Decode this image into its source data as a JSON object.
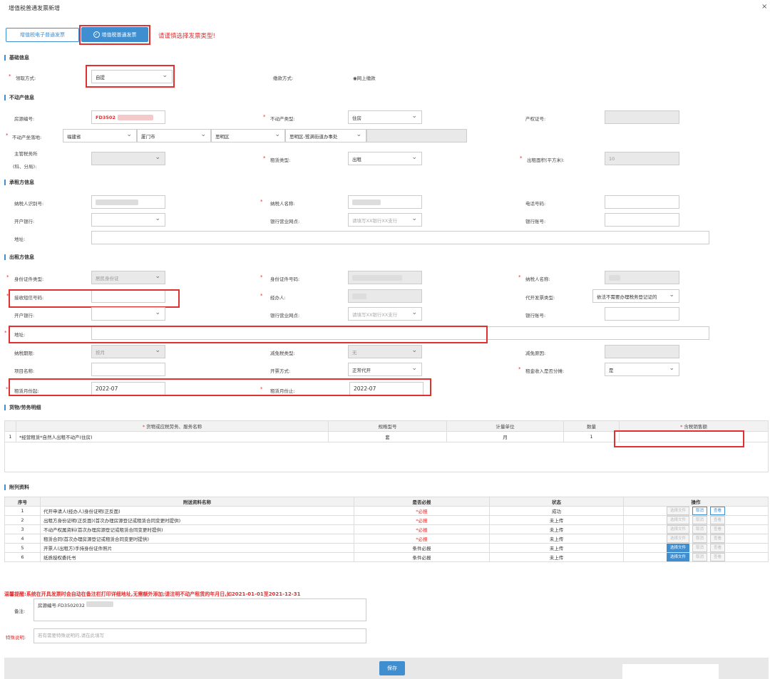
{
  "window": {
    "title": "增值税普通发票新增",
    "close": "×"
  },
  "tabs": [
    {
      "label": "增值税电子普通发票"
    },
    {
      "label": "增值税普通发票"
    }
  ],
  "warning": "请谨慎选择发票类型!",
  "sections": {
    "basic": "基础信息",
    "property": "不动产信息",
    "lessee": "承租方信息",
    "lessor": "出租方信息",
    "goods": "货物/劳务明细",
    "attachments": "附列资料"
  },
  "basic": {
    "pickup_label": "领取方式:",
    "pickup_value": "自提",
    "pay_label": "缴款方式:",
    "pay_value": "网上缴款"
  },
  "property": {
    "source_no_label": "房源编号:",
    "source_no_value": "FD3502",
    "type_label": "不动产类型:",
    "type_value": "住房",
    "cert_label": "产权证号:",
    "location_label": "不动产坐落地:",
    "province": "福建省",
    "city": "厦门市",
    "district": "思明区",
    "street": "思明区-鹭满街道办事处",
    "tax_office_label": "主管税务所",
    "tax_office_label2": "(科、分局):",
    "lease_type_label": "租赁类型:",
    "lease_type_value": "出租",
    "area_label": "出租面积(平方米):",
    "area_value": "10"
  },
  "lessee": {
    "taxid_label": "纳税人识别号:",
    "name_label": "纳税人名称:",
    "phone_label": "电话号码:",
    "bank_label": "开户银行:",
    "branch_label": "银行营业网点:",
    "branch_placeholder": "请填写XX银行XX支行",
    "account_label": "银行账号:",
    "address_label": "地址:"
  },
  "lessor": {
    "id_type_label": "身份证件类型:",
    "id_type_value": "居民身份证",
    "id_no_label": "身份证件号码:",
    "name_label": "纳税人名称:",
    "sms_label": "接收短信号码:",
    "agent_label": "经办人:",
    "invoice_type_label": "代开发票类型:",
    "invoice_type_value": "依法不需要办理税务登记证的",
    "bank_label": "开户银行:",
    "branch_label": "银行营业网点:",
    "branch_placeholder": "请填写XX银行XX支行",
    "account_label": "银行账号:",
    "address_label": "地址:",
    "period_label": "纳税期限:",
    "period_value": "按月",
    "reduce_type_label": "减免税类型:",
    "reduce_type_value": "无",
    "reduce_reason_label": "减免原因:",
    "project_label": "项目名称:",
    "issue_label": "开票方式:",
    "issue_value": "正常代开",
    "split_label": "租金收入是否分摊:",
    "split_value": "是",
    "start_label": "租赁月份起:",
    "start_value": "2022-07",
    "end_label": "租赁月份止:",
    "end_value": "2022-07"
  },
  "goods": {
    "headers": [
      "货物或应税劳务、服务名称",
      "规格型号",
      "计量单位",
      "数量",
      "含税销售额"
    ],
    "rows": [
      {
        "no": "1",
        "name": "*经营租赁*自然人出租不动产(住房)",
        "spec": "套",
        "unit": "月",
        "qty": "1",
        "amount": ""
      }
    ]
  },
  "attachments": {
    "headers": [
      "序号",
      "附送资料名称",
      "是否必报",
      "状态",
      "操作"
    ],
    "rows": [
      {
        "no": "1",
        "name": "代开申请人(经办人)身份证明(正反面)",
        "required": "*必报",
        "status": "成功"
      },
      {
        "no": "2",
        "name": "出租方身份证明(正反面)(首次办理房源登记或租赁合同变更时提供)",
        "required": "*必报",
        "status": "未上传"
      },
      {
        "no": "3",
        "name": "不动产权属资料(首次办理房源登记或租赁合同变更时提供)",
        "required": "*必报",
        "status": "未上传"
      },
      {
        "no": "4",
        "name": "租赁合同(首次办理房源登记或租赁合同变更时提供)",
        "required": "*必报",
        "status": "未上传"
      },
      {
        "no": "5",
        "name": "开票人(出租方)手持身份证件照片",
        "required": "条件必报",
        "status": "未上传"
      },
      {
        "no": "6",
        "name": "纸质授权委托书",
        "required": "条件必报",
        "status": "未上传"
      }
    ],
    "btn_select": "选择文件",
    "btn_cancel": "取消",
    "btn_view": "查看"
  },
  "tip": "温馨提醒:系统在开具发票时会自动在备注栏打印详细地址,无需额外添加;请注明不动产租赁的年月日,如2021-01-01至2021-12-31",
  "remark_label": "备注:",
  "remark_value": "房源编号:FD3502032",
  "special_label": "特殊说明:",
  "special_placeholder": "若有需要特殊说明的,请在此填写",
  "save": "保存"
}
